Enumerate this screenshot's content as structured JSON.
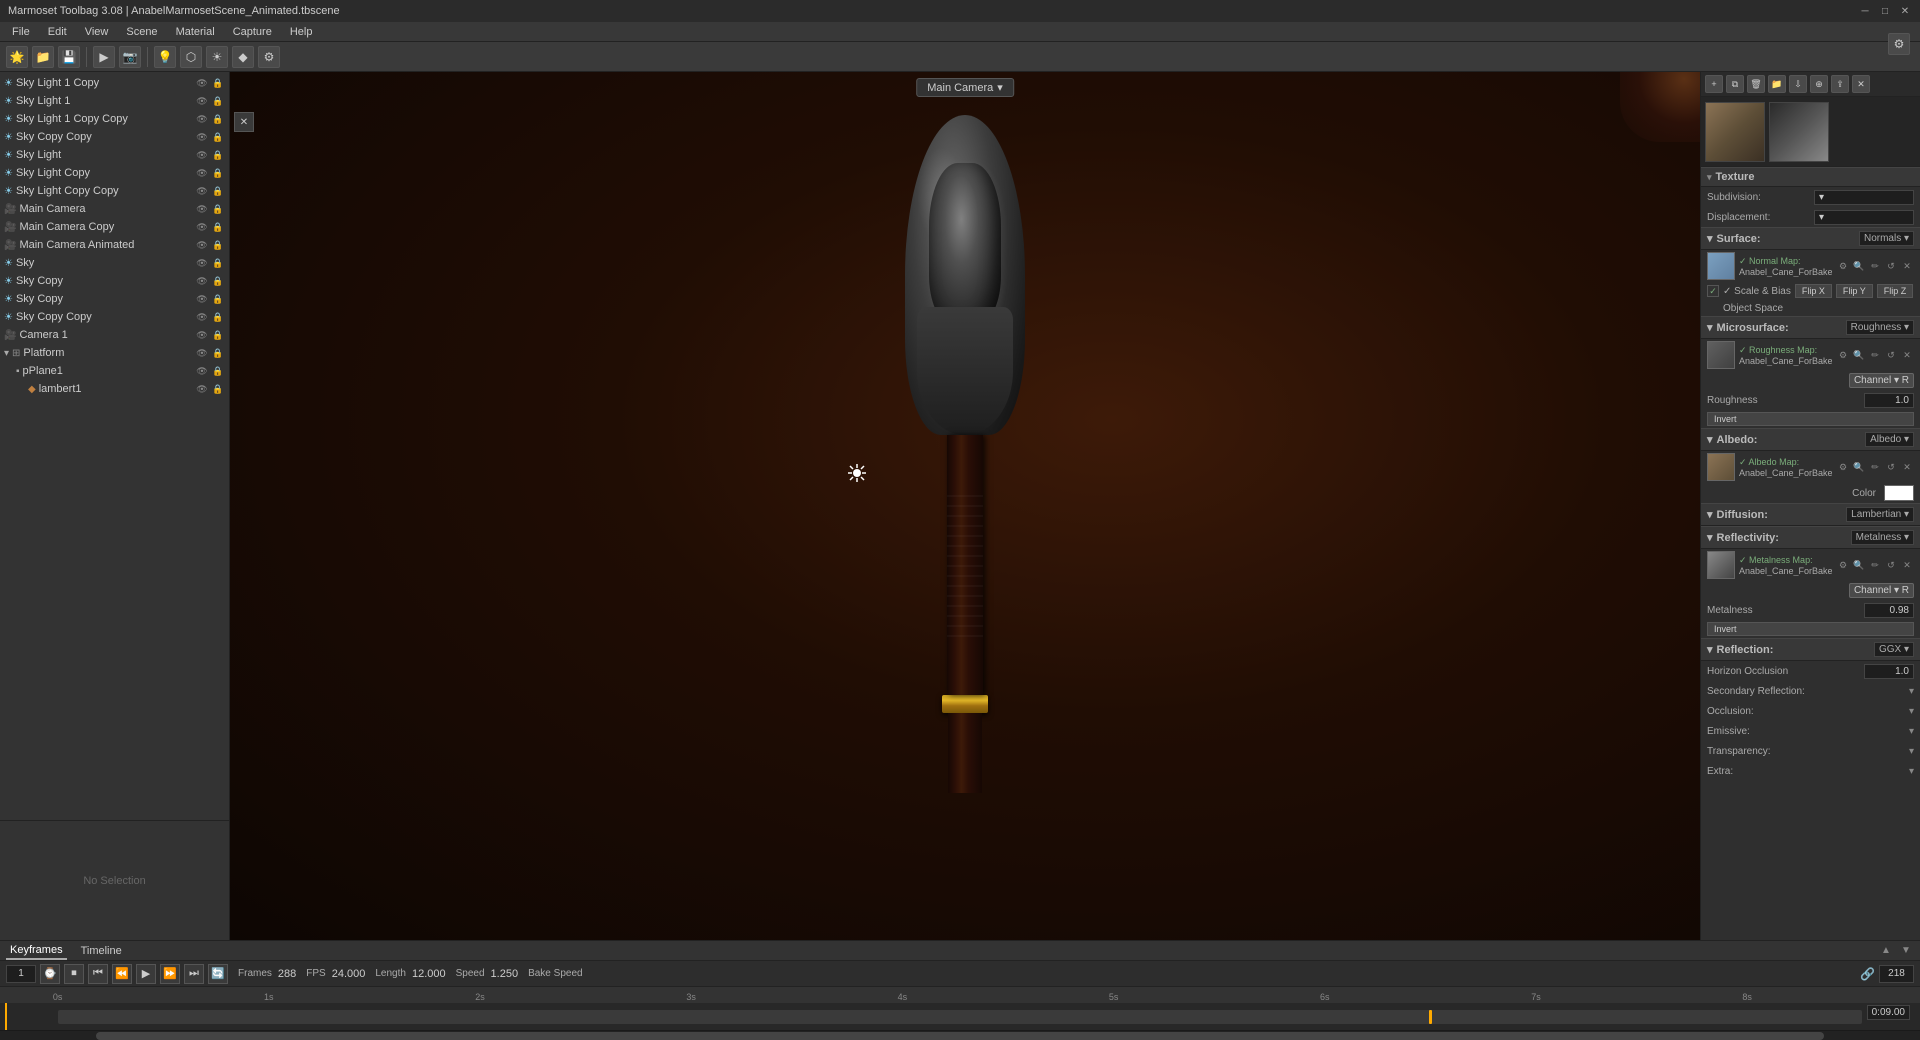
{
  "titlebar": {
    "title": "Marmoset Toolbag 3.08 | AnabelMarmosetScene_Animated.tbscene",
    "minimize": "─",
    "maximize": "□",
    "close": "✕"
  },
  "menubar": {
    "items": [
      "File",
      "Edit",
      "View",
      "Scene",
      "Material",
      "Capture",
      "Help"
    ]
  },
  "viewport": {
    "camera_label": "Main Camera",
    "camera_arrow": "▾"
  },
  "scene_tree": {
    "items": [
      {
        "id": "sky-light-1-copy",
        "label": "Sky Light 1 Copy",
        "indent": 0,
        "type": "sky",
        "icon": "☀"
      },
      {
        "id": "sky-light-1",
        "label": "Sky Light 1",
        "indent": 0,
        "type": "sky",
        "icon": "☀"
      },
      {
        "id": "sky-light-1-copy-copy",
        "label": "Sky Light 1 Copy Copy",
        "indent": 0,
        "type": "sky",
        "icon": "☀"
      },
      {
        "id": "sky-copy-copy",
        "label": "Sky Copy Copy",
        "indent": 0,
        "type": "sky",
        "icon": "☀"
      },
      {
        "id": "sky-light",
        "label": "Sky Light",
        "indent": 0,
        "type": "sky",
        "icon": "☀"
      },
      {
        "id": "sky-light-copy",
        "label": "Sky Light Copy",
        "indent": 0,
        "type": "sky",
        "icon": "☀"
      },
      {
        "id": "sky-light-copy-copy",
        "label": "Sky Light Copy Copy",
        "indent": 0,
        "type": "sky",
        "icon": "☀"
      },
      {
        "id": "main-camera",
        "label": "Main Camera",
        "indent": 0,
        "type": "camera",
        "icon": "📷"
      },
      {
        "id": "main-camera-copy",
        "label": "Main Camera Copy",
        "indent": 0,
        "type": "camera",
        "icon": "📷"
      },
      {
        "id": "main-camera-animated",
        "label": "Main Camera Animated",
        "indent": 0,
        "type": "camera",
        "icon": "📷"
      },
      {
        "id": "sky",
        "label": "Sky",
        "indent": 0,
        "type": "sky",
        "icon": "☀"
      },
      {
        "id": "sky-copy",
        "label": "Sky Copy",
        "indent": 0,
        "type": "sky",
        "icon": "☀"
      },
      {
        "id": "sky-copy-2",
        "label": "Sky Copy",
        "indent": 0,
        "type": "sky",
        "icon": "☀"
      },
      {
        "id": "sky-copy-copy-2",
        "label": "Sky Copy Copy",
        "indent": 0,
        "type": "sky",
        "icon": "☀"
      },
      {
        "id": "camera-1",
        "label": "Camera 1",
        "indent": 0,
        "type": "camera",
        "icon": "📷"
      },
      {
        "id": "platform",
        "label": "Platform",
        "indent": 0,
        "type": "group",
        "icon": "▸"
      },
      {
        "id": "pplane1",
        "label": "pPlane1",
        "indent": 1,
        "type": "mesh",
        "icon": "▪"
      },
      {
        "id": "lambert1",
        "label": "lambert1",
        "indent": 2,
        "type": "material",
        "icon": "◆"
      }
    ],
    "no_selection": "No Selection"
  },
  "right_panel": {
    "texture_section": {
      "label": "Texture"
    },
    "subdivision_label": "Subdivision:",
    "displacement_label": "Displacement:",
    "surface_section": {
      "label": "Surface:",
      "value": "Normals ▾"
    },
    "normal_map": {
      "label": "✓ Normal Map:",
      "value": "Anabel_Cane_ForBake_Car...",
      "controls": [
        "⚙",
        "🔍",
        "✏",
        "↺",
        "✕"
      ]
    },
    "scale_bias_label": "✓ Scale & Bias",
    "flip_x": "Flip X",
    "flip_y": "Flip Y",
    "flip_z": "Flip Z",
    "object_space_label": "Object Space",
    "microsurface_section": {
      "label": "Microsurface:",
      "value": "Roughness ▾"
    },
    "roughness_map": {
      "label": "✓ Roughness Map:",
      "value": "Anabel_Cane_ForBake...",
      "controls": [
        "⚙",
        "🔍",
        "✏",
        "↺",
        "✕"
      ]
    },
    "channel_r": "Channel ▾ R",
    "roughness_label": "Roughness",
    "roughness_value": "1.0",
    "invert_label": "Invert",
    "albedo_section": {
      "label": "Albedo:",
      "value": "Albedo ▾"
    },
    "albedo_map": {
      "label": "✓ Albedo Map:",
      "value": "Anabel_Cane_ForBake_Can...",
      "controls": [
        "⚙",
        "🔍",
        "✏",
        "↺",
        "✕"
      ]
    },
    "color_label": "Color",
    "diffusion_section": {
      "label": "Diffusion:",
      "value": "Lambertian ▾"
    },
    "reflectivity_section": {
      "label": "Reflectivity:",
      "value": "Metalness ▾"
    },
    "metalness_map": {
      "label": "✓ Metalness Map:",
      "value": "Anabel_Cane_ForBake_C...",
      "controls": [
        "⚙",
        "🔍",
        "✏",
        "↺",
        "✕"
      ]
    },
    "channel_r2": "Channel ▾ R",
    "metalness_label": "Metalness",
    "metalness_value": "0.98",
    "invert2_label": "Invert",
    "reflection_section": {
      "label": "Reflection:",
      "value": "GGX ▾"
    },
    "horizon_occlusion_label": "Horizon Occlusion",
    "horizon_occlusion_value": "1.0",
    "secondary_reflection_label": "Secondary Reflection:",
    "occlusion_label": "Occlusion:",
    "emissive_label": "Emissive:",
    "transparency_label": "Transparency:",
    "extra_label": "Extra:"
  },
  "timeline": {
    "keyframes_tab": "Keyframes",
    "timeline_tab": "Timeline",
    "frame_current": "1",
    "frames_label": "Frames",
    "frames_value": "288",
    "fps_label": "FPS",
    "fps_value": "24.000",
    "length_label": "Length",
    "length_value": "12.000",
    "speed_label": "Speed",
    "speed_value": "1.250",
    "bake_speed_label": "Bake Speed",
    "time_display": "0:09.00",
    "ruler_marks": [
      "0s",
      "1s",
      "2s",
      "3s",
      "4s",
      "5s",
      "6s",
      "7s",
      "8s"
    ],
    "transport_btns": [
      "⏹",
      "⏮",
      "⏪",
      "⏵",
      "⏩",
      "⏭",
      "🔄"
    ],
    "frame_value": "218"
  }
}
